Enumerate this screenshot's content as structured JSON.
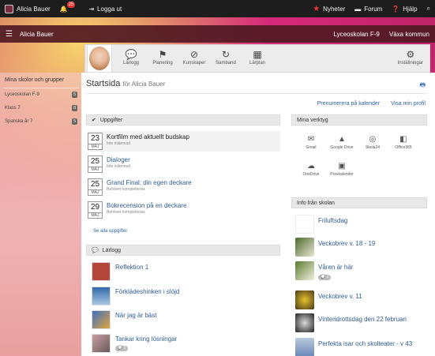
{
  "topbar": {
    "user": "Alicia Bauer",
    "notif_count": "25",
    "logout": "Logga ut",
    "news": "Nyheter",
    "forum": "Forum",
    "help": "Hjälp"
  },
  "subbar": {
    "user": "Alicia Bauer",
    "school": "Lyceoskolan F-9",
    "municipality": "Växa kommun"
  },
  "profilenav": [
    {
      "label": "Lärlogg",
      "icon": "speech-bubble-icon"
    },
    {
      "label": "Planering",
      "icon": "flag-icon"
    },
    {
      "label": "Kunskaper",
      "icon": "no-entry-icon"
    },
    {
      "label": "Samband",
      "icon": "refresh-icon"
    },
    {
      "label": "Lärplan",
      "icon": "map-icon"
    }
  ],
  "settings_label": "Inställningar",
  "sidebar": {
    "heading": "Mina skolor och grupper",
    "items": [
      {
        "label": "Lyceoskolan F-9",
        "count": "5"
      },
      {
        "label": "Klass 7",
        "count": "8"
      },
      {
        "label": "Spanska år 7",
        "count": "5"
      }
    ]
  },
  "main": {
    "title": "Startsida",
    "subtitle": "för Alicia Bauer",
    "link_subscribe": "Prenumerera på kalender",
    "link_profile": "Visa min profil"
  },
  "tasks_header": "Uppgifter",
  "tasks": [
    {
      "day": "23",
      "month": "MAJ",
      "title": "Kortfilm med aktuellt budskap",
      "status": "Inte inlämnad"
    },
    {
      "day": "25",
      "month": "MAJ",
      "title": "Dialoger",
      "status": "Inte inlämnad"
    },
    {
      "day": "25",
      "month": "MAJ",
      "title": "Grand Final: din egen deckare",
      "status": "Behöver kompletteras"
    },
    {
      "day": "29",
      "month": "MAJ",
      "title": "Bokrecension på en deckare",
      "status": "Behöver kompletteras"
    }
  ],
  "tasks_see_all": "Se alla uppgifter",
  "log_header": "Lärlogg",
  "logs": [
    {
      "title": "Reflektion 1",
      "color": "#b4463a",
      "badge": ""
    },
    {
      "title": "Förklädeshinken i slöjd",
      "color": "#4a7fb0",
      "badge": ""
    },
    {
      "title": "När jag är bäst",
      "color": "#3d6fc2",
      "badge": ""
    },
    {
      "title": "Tankar kring lösningar",
      "color": "#c9a0a4",
      "badge": "1"
    }
  ],
  "tools_header": "Mina verktyg",
  "tools": [
    {
      "label": "Gmail",
      "icon": "gmail-icon"
    },
    {
      "label": "Google Drive",
      "icon": "google-drive-icon"
    },
    {
      "label": "Skola24",
      "icon": "skola24-icon"
    },
    {
      "label": "Office365",
      "icon": "office-icon"
    },
    {
      "label": "OneDrive",
      "icon": "cloud-icon"
    },
    {
      "label": "Provkalender",
      "icon": "calendar-icon"
    }
  ],
  "info_header": "Info från skolan",
  "infos": [
    {
      "title": "Friluftsdag",
      "color": "#ffffff",
      "badge": ""
    },
    {
      "title": "Veckobrev v. 18 - 19",
      "color": "#4c6b2c",
      "badge": ""
    },
    {
      "title": "Våren är här",
      "color": "#5a7a2d",
      "badge": "1"
    },
    {
      "title": "Veckobrev v. 11",
      "color": "#caa31f",
      "badge": ""
    },
    {
      "title": "Vinteridrottsdag den 22 februari",
      "color": "#2a2a2a",
      "badge": ""
    },
    {
      "title": "Perfekta isar och skolteater - v 43",
      "color": "#6a88b5",
      "badge": ""
    }
  ]
}
